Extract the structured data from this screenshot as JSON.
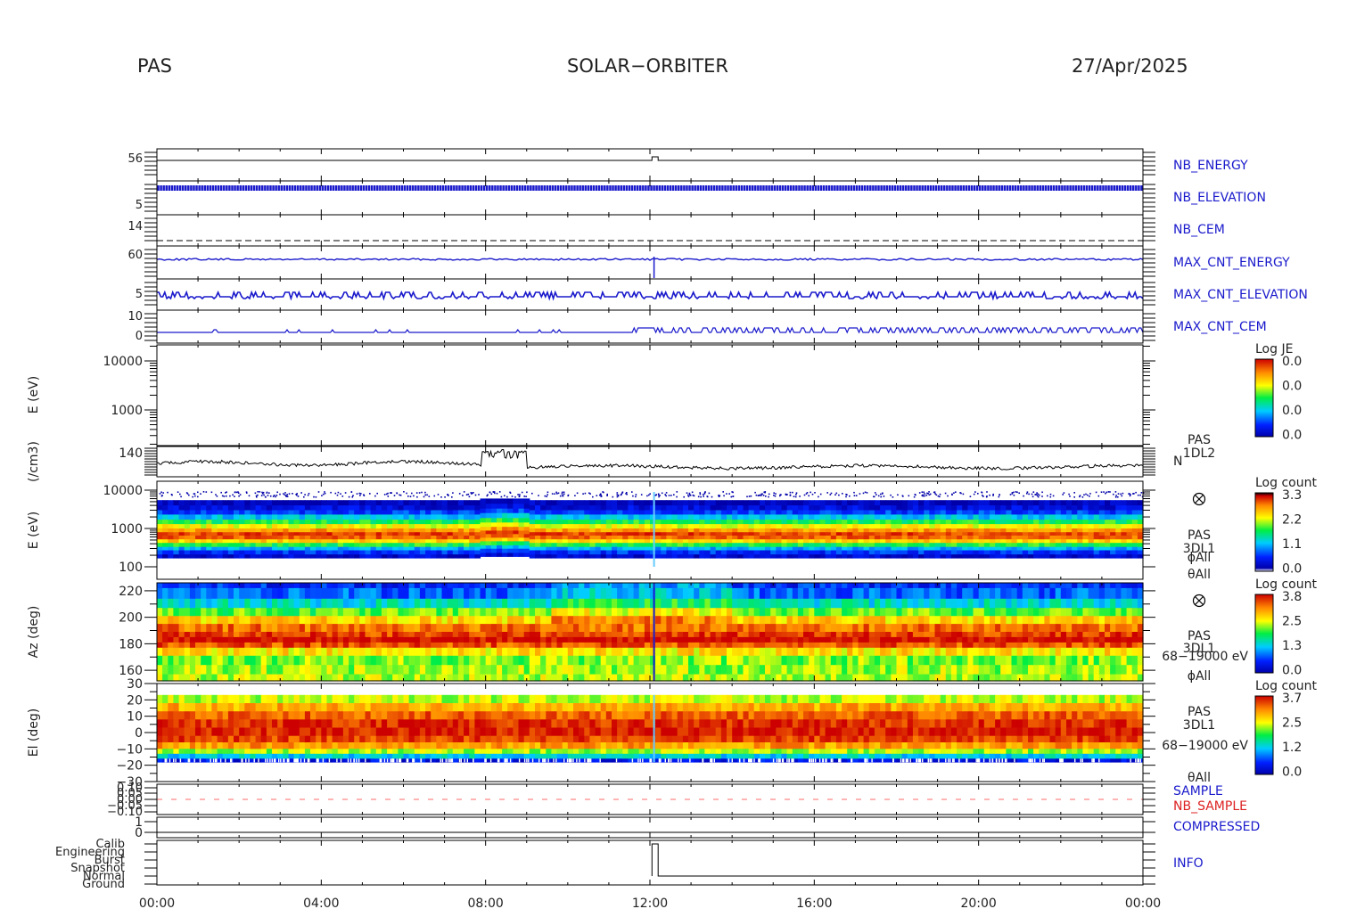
{
  "header": {
    "left": "PAS",
    "center": "SOLAR−ORBITER",
    "right": "27/Apr/2025"
  },
  "colors": {
    "blue_label": "#1a1acc",
    "red_label": "#dd2222",
    "frame": "#000000"
  },
  "chart_data": {
    "type": "multi-panel",
    "x_axis": {
      "ticks": [
        "00:00",
        "04:00",
        "08:00",
        "12:00",
        "16:00",
        "20:00",
        "00:00"
      ],
      "range_hours": [
        0,
        24
      ]
    },
    "panels": [
      {
        "id": "nb_energy",
        "type": "line",
        "label": "NB_ENERGY",
        "note": "constant with step near 12:00"
      },
      {
        "id": "nb_elevation",
        "type": "line",
        "label": "NB_ELEVATION"
      },
      {
        "id": "nb_cem",
        "type": "line",
        "label": "NB_CEM"
      },
      {
        "id": "max_cnt_energy",
        "type": "line",
        "label": "MAX_CNT_ENERGY"
      },
      {
        "id": "max_cnt_elevation",
        "type": "line",
        "label": "MAX_CNT_ELEVATION"
      },
      {
        "id": "max_cnt_cem",
        "type": "line",
        "label": "MAX_CNT_CEM",
        "yticks": [
          "10"
        ]
      },
      {
        "id": "e_je",
        "type": "heatmap",
        "ylabel": "E (eV)",
        "yticks": [
          "10000",
          "1000"
        ],
        "scale": "log",
        "colorbar": {
          "title": "Log JE",
          "ticks": [
            "0.0",
            "0.0",
            "0.0",
            "0.0"
          ]
        }
      },
      {
        "id": "density",
        "type": "line",
        "ylabel": "(/cm3)",
        "yticks": [
          "140"
        ],
        "right_labels": [
          "PAS",
          "1DL2",
          "N"
        ]
      },
      {
        "id": "e_count",
        "type": "heatmap",
        "ylabel": "E (eV)",
        "yticks": [
          "10000",
          "1000",
          "100"
        ],
        "scale": "log",
        "colorbar": {
          "title": "Log count",
          "ticks": [
            "3.3",
            "2.2",
            "1.1",
            "0.0"
          ]
        },
        "right_labels": [
          "PAS",
          "3DL1",
          "ϕAll",
          "θAll"
        ]
      },
      {
        "id": "az",
        "type": "heatmap",
        "ylabel": "Az (deg)",
        "yticks": [
          "220",
          "200",
          "180",
          "160"
        ],
        "ylim": [
          152,
          226
        ],
        "colorbar": {
          "title": "Log count",
          "ticks": [
            "3.8",
            "2.5",
            "1.3",
            "0.0"
          ]
        },
        "right_labels": [
          "PAS",
          "3DL1",
          "68−19000 eV",
          "ϕAll"
        ]
      },
      {
        "id": "el",
        "type": "heatmap",
        "ylabel": "El (deg)",
        "yticks": [
          "30",
          "20",
          "10",
          "0",
          "−10",
          "−20",
          "−30"
        ],
        "ylim": [
          -30,
          30
        ],
        "colorbar": {
          "title": "Log count",
          "ticks": [
            "3.7",
            "2.5",
            "1.2",
            "0.0"
          ]
        },
        "right_labels": [
          "PAS",
          "3DL1",
          "68−19000 eV",
          "θAll"
        ]
      },
      {
        "id": "sample",
        "type": "line",
        "labels": [
          "SAMPLE",
          "NB_SAMPLE"
        ],
        "yticks": [
          "0.10",
          "0.05",
          "0.00",
          "−0.05",
          "−0.10"
        ]
      },
      {
        "id": "compressed",
        "type": "line",
        "label": "COMPRESSED",
        "yticks": [
          "1",
          "0"
        ]
      },
      {
        "id": "info",
        "type": "line",
        "label": "INFO",
        "yticks": [
          "Calib",
          "Engineering",
          "Burst",
          "Snapshot",
          "Normal",
          "Ground"
        ]
      }
    ]
  }
}
